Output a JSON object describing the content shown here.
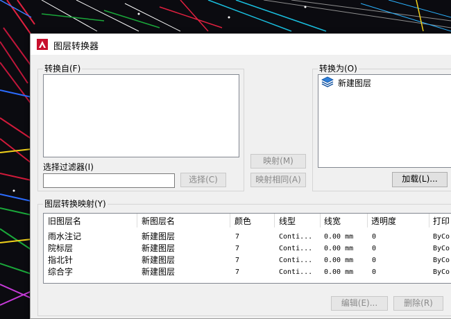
{
  "dialog": {
    "title": "图层转换器",
    "app_icon": "autocad-logo-icon"
  },
  "source": {
    "group_label": "转换自(F)"
  },
  "filter": {
    "label": "选择过滤器(I)",
    "value": "",
    "select_button": "选择(C)"
  },
  "mapping_buttons": {
    "map": "映射(M)",
    "map_same": "映射相同(A)"
  },
  "target": {
    "group_label": "转换为(O)",
    "items": [
      {
        "icon": "layer-stack-icon",
        "label": "新建图层"
      }
    ],
    "load_button": "加载(L)..."
  },
  "layer_mapping": {
    "group_label": "图层转换映射(Y)",
    "columns": [
      "旧图层名",
      "新图层名",
      "颜色",
      "线型",
      "线宽",
      "透明度",
      "打印"
    ],
    "rows": [
      {
        "old": "雨水注记",
        "new": "新建图层",
        "color": "7",
        "linetype": "Conti...",
        "lineweight": "0.00 mm",
        "transparency": "0",
        "plot": "ByCo"
      },
      {
        "old": "院标层",
        "new": "新建图层",
        "color": "7",
        "linetype": "Conti...",
        "lineweight": "0.00 mm",
        "transparency": "0",
        "plot": "ByCo"
      },
      {
        "old": "指北针",
        "new": "新建图层",
        "color": "7",
        "linetype": "Conti...",
        "lineweight": "0.00 mm",
        "transparency": "0",
        "plot": "ByCo"
      },
      {
        "old": "综合字",
        "new": "新建图层",
        "color": "7",
        "linetype": "Conti...",
        "lineweight": "0.00 mm",
        "transparency": "0",
        "plot": "ByCo"
      }
    ],
    "edit_button": "编辑(E)...",
    "delete_button": "删除(R)"
  }
}
